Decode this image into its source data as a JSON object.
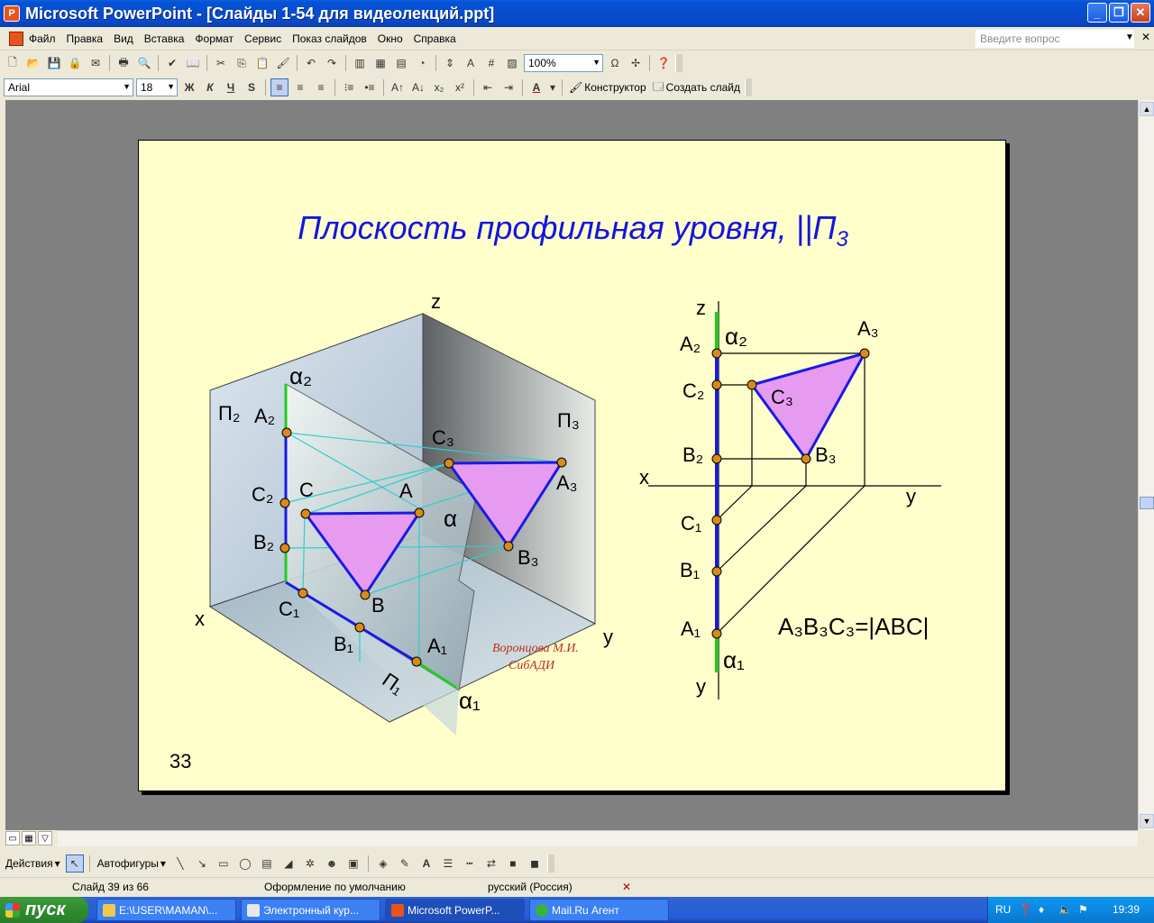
{
  "window": {
    "title": "Microsoft PowerPoint - [Слайды 1-54 для видеолекций.ppt]"
  },
  "menu": [
    "Файл",
    "Правка",
    "Вид",
    "Вставка",
    "Формат",
    "Сервис",
    "Показ слайдов",
    "Окно",
    "Справка"
  ],
  "help_box": {
    "placeholder": "Введите вопрос"
  },
  "toolbar": {
    "zoom": "100%"
  },
  "format_toolbar": {
    "font": "Arial",
    "size": "18",
    "bold": "Ж",
    "italic": "К",
    "underline": "Ч",
    "shadow": "S",
    "designer": "Конструктор",
    "new_slide": "Создать слайд"
  },
  "slide": {
    "title": "Плоскость профильная уровня, ||П",
    "title_sub": "3",
    "number": "33",
    "author_line1": "Воронцова М.И.",
    "author_line2": "СибАДИ",
    "formula": "A₃B₃C₃=|ABC|",
    "left_labels": [
      "z",
      "x",
      "y",
      "α₂",
      "α₁",
      "α",
      "П₂",
      "П₃",
      "П₁",
      "A₂",
      "C₂",
      "B₂",
      "C₁",
      "B₁",
      "A₁",
      "C",
      "A",
      "B",
      "C₃",
      "A₃",
      "B₃"
    ],
    "right_labels": [
      "z",
      "x",
      "y",
      "y",
      "α₂",
      "α₁",
      "A₂",
      "C₂",
      "B₂",
      "C₁",
      "B₁",
      "A₁",
      "A₃",
      "C₃",
      "B₃"
    ]
  },
  "drawing_toolbar": {
    "actions": "Действия",
    "autoshapes": "Автофигуры"
  },
  "status": {
    "slide": "Слайд 39 из 66",
    "design": "Оформление по умолчанию",
    "lang": "русский (Россия)"
  },
  "taskbar": {
    "start": "пуск",
    "tasks": [
      "E:\\USER\\MAMAN\\...",
      "Электронный кур...",
      "Microsoft PowerP...",
      "Mail.Ru Агент"
    ],
    "lang": "RU",
    "clock": "19:39"
  },
  "colors": {
    "title_blue": "#1414e0",
    "slide_bg": "#ffffcc",
    "triangle_fill": "#e69bf0",
    "edge_blue": "#1a1ae6",
    "line_green": "#22cc22",
    "point_orange": "#d98a1a"
  }
}
